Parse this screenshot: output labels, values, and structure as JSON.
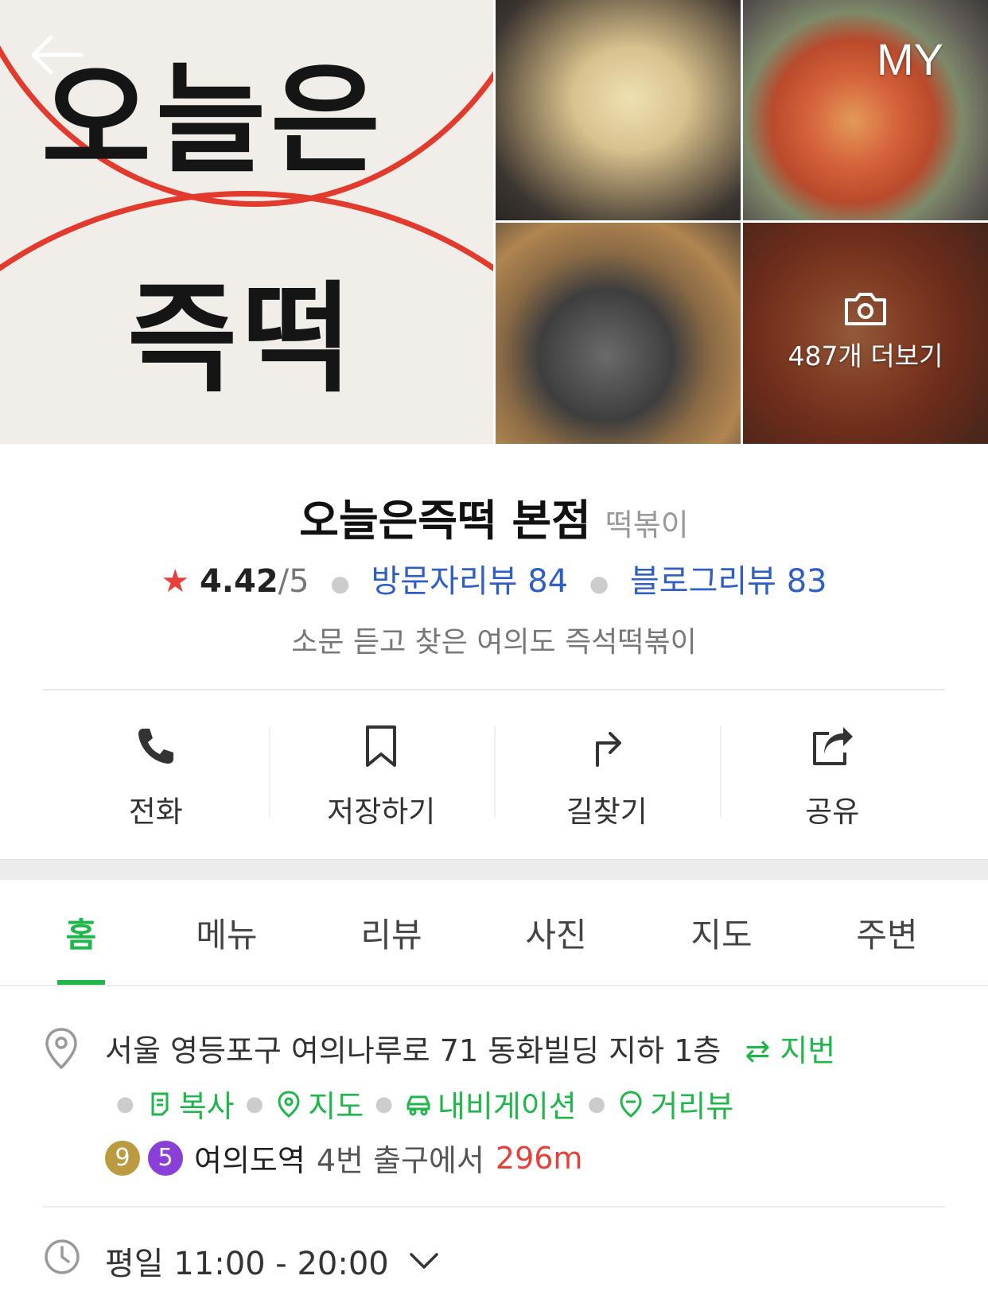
{
  "header": {
    "my_label": "MY",
    "photo_more": "487개 더보기",
    "sign_line1": "오늘은",
    "sign_line2": "즉떡"
  },
  "place": {
    "name": "오늘은즉떡 본점",
    "category": "떡볶이",
    "rating": "4.42",
    "rating_max": "/5",
    "visitor_reviews": "방문자리뷰 84",
    "blog_reviews": "블로그리뷰 83",
    "description": "소문 듣고 찾은 여의도 즉석떡볶이"
  },
  "actions": [
    {
      "label": "전화",
      "icon": "phone-icon"
    },
    {
      "label": "저장하기",
      "icon": "bookmark-icon"
    },
    {
      "label": "길찾기",
      "icon": "directions-icon"
    },
    {
      "label": "공유",
      "icon": "share-icon"
    }
  ],
  "tabs": [
    "홈",
    "메뉴",
    "리뷰",
    "사진",
    "지도",
    "주변"
  ],
  "active_tab": "홈",
  "info": {
    "address": "서울 영등포구 여의나루로 71 동화빌딩 지하 1층",
    "jibun_label": "지번",
    "copy_label": "복사",
    "map_label": "지도",
    "navigation_label": "내비게이션",
    "streetview_label": "거리뷰",
    "subway_lines": [
      "9",
      "5"
    ],
    "station": "여의도역",
    "exit": "4번 출구에서",
    "distance": "296m",
    "hours": "평일 11:00 - 20:00"
  },
  "colors": {
    "accent_green": "#1fb74a",
    "link_blue": "#2f5fc4",
    "star_red": "#e5403a",
    "line9": "#bb9a40",
    "line5": "#8a3fd6"
  }
}
